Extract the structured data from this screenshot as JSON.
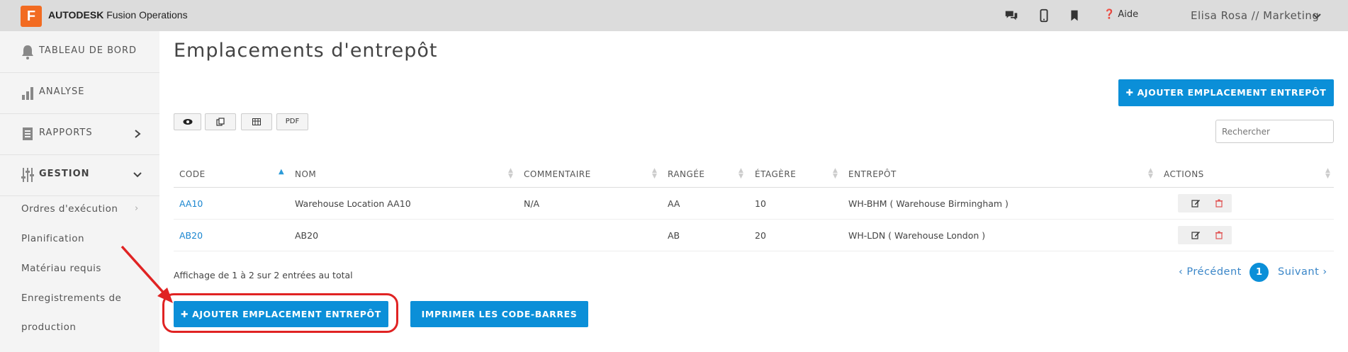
{
  "topbar": {
    "logo_letter": "F",
    "brand_bold": "AUTODESK",
    "brand_rest": " Fusion Operations",
    "help_label": "Aide",
    "user_label": "Elisa Rosa // Marketing",
    "icons": [
      "chat-icon",
      "mobile-icon",
      "bookmark-icon",
      "help-icon",
      "chevron-down-icon"
    ]
  },
  "sidebar": {
    "items": [
      {
        "label": "TABLEAU DE BORD",
        "icon": "bell-icon"
      },
      {
        "label": "ANALYSE",
        "icon": "bar-chart-icon"
      },
      {
        "label": "RAPPORTS",
        "icon": "report-icon",
        "chevron": "right"
      },
      {
        "label": "GESTION",
        "icon": "sliders-icon",
        "chevron": "down"
      }
    ],
    "subitems": [
      {
        "label": "Ordres d'exécution"
      },
      {
        "label": "Planification"
      },
      {
        "label": "Matériau requis"
      },
      {
        "label": "Enregistrements de"
      },
      {
        "label": "production"
      }
    ],
    "sub_chevron": "›"
  },
  "main": {
    "title": "Emplacements d'entrepôt",
    "add_button_label": "AJOUTER EMPLACEMENT ENTREPÔT",
    "toolbar": {
      "pdf_label": "PDF"
    },
    "search_placeholder": "Rechercher",
    "table": {
      "headers": [
        "CODE",
        "NOM",
        "COMMENTAIRE",
        "RANGÉE",
        "ÉTAGÈRE",
        "ENTREPÔT",
        "ACTIONS"
      ],
      "rows": [
        {
          "code": "AA10",
          "nom": "Warehouse Location AA10",
          "commentaire": "N/A",
          "rangee": "AA",
          "etagere": "10",
          "entrepot": "WH-BHM ( Warehouse Birmingham )"
        },
        {
          "code": "AB20",
          "nom": "AB20",
          "commentaire": "",
          "rangee": "AB",
          "etagere": "20",
          "entrepot": "WH-LDN ( Warehouse London )"
        }
      ]
    },
    "info_text": "Affichage de 1 à 2 sur 2 entrées au total",
    "pagination": {
      "prev": "‹ Précédent",
      "current": "1",
      "next": "Suivant ›"
    },
    "bottom_buttons": {
      "add_label": "AJOUTER EMPLACEMENT ENTREPÔT",
      "print_label": "IMPRIMER LES CODE-BARRES"
    }
  },
  "colors": {
    "accent": "#0b8fd8",
    "brand_orange": "#f26b21",
    "annotation_red": "#e02323",
    "delete_red": "#e05050"
  }
}
